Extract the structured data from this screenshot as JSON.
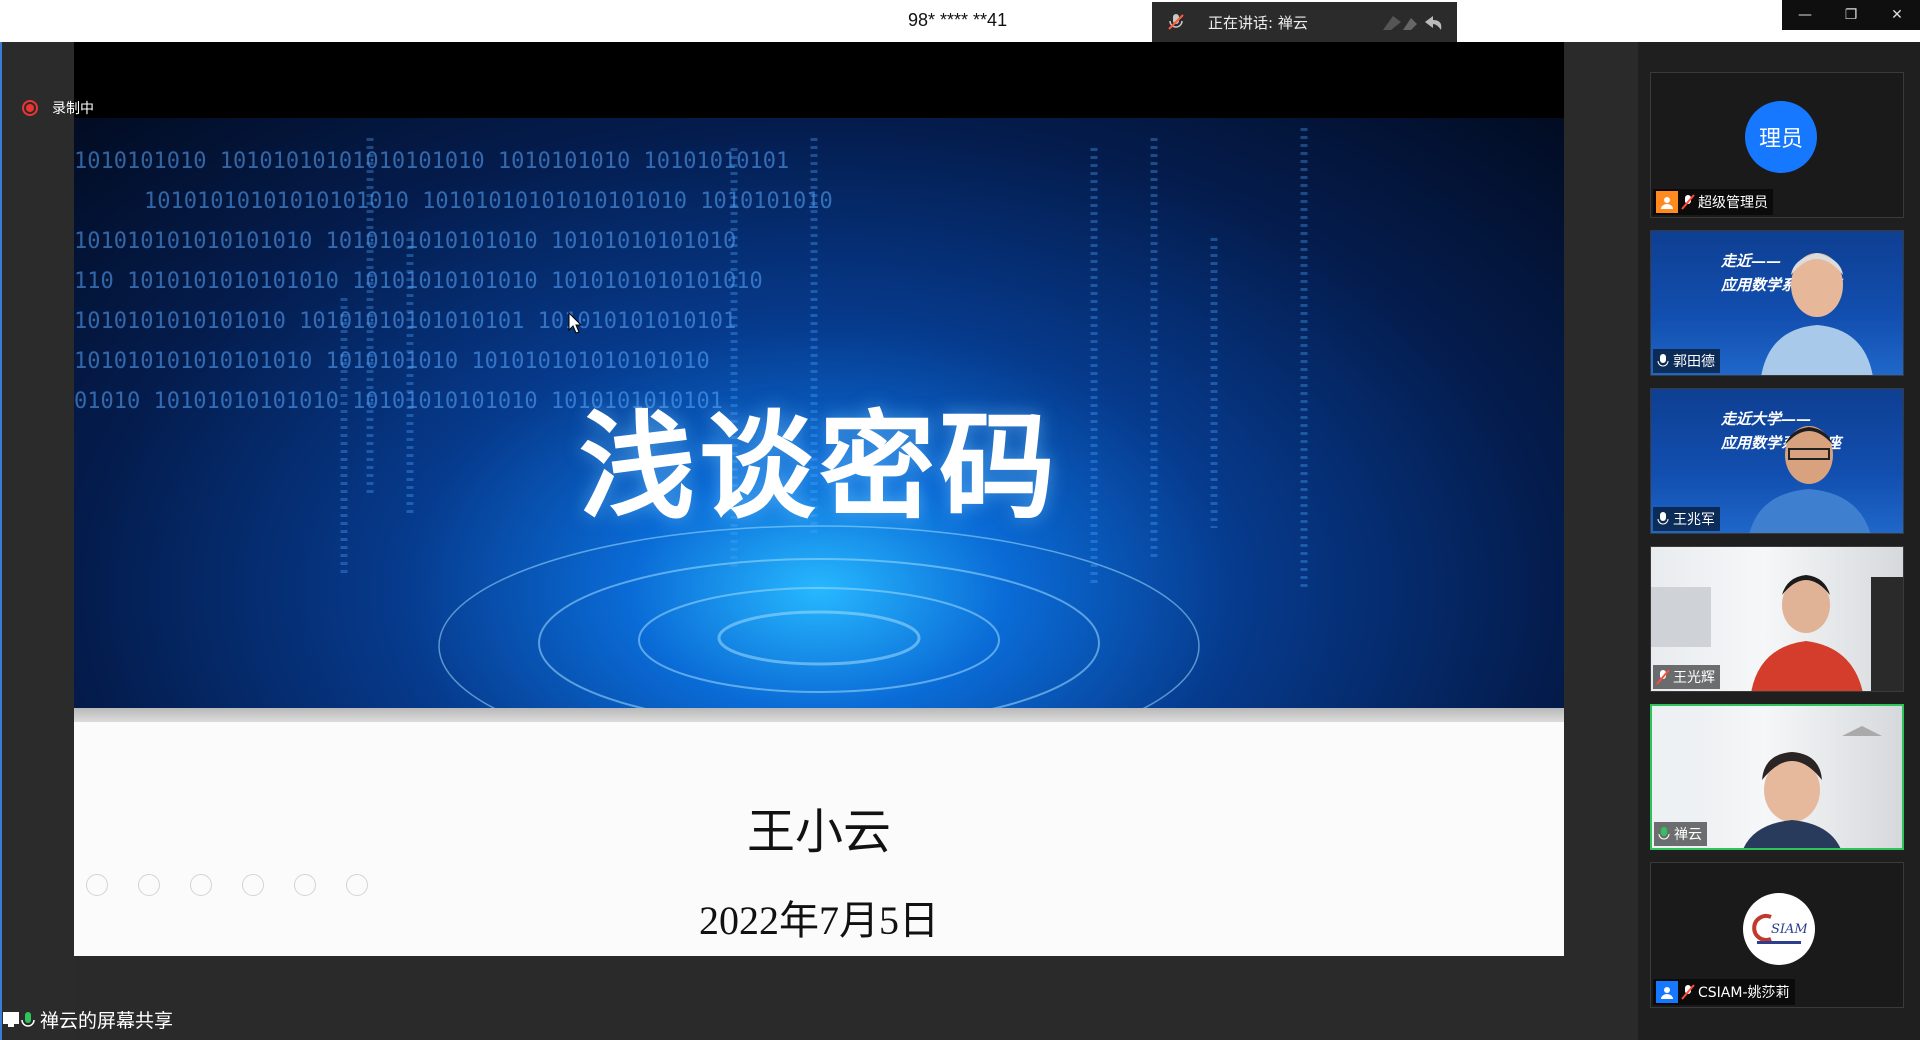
{
  "topbar": {
    "meeting_id": "98* **** **41",
    "speaking_label": "正在讲话: 禅云"
  },
  "window_controls": {
    "minimize": "—",
    "restore": "❐",
    "close": "✕"
  },
  "recording": {
    "label": "录制中"
  },
  "slide": {
    "title": "浅谈密码",
    "author": "王小云",
    "date": "2022年7月5日"
  },
  "share_label": "禅云的屏幕共享",
  "participants": [
    {
      "name": "超级管理员",
      "avatar_text": "理员",
      "mic": "muted",
      "type": "avatar"
    },
    {
      "name": "郭田德",
      "mic": "on",
      "type": "video",
      "banner": [
        "走近——",
        "应用数学系普讲座"
      ]
    },
    {
      "name": "王兆军",
      "mic": "on",
      "type": "video",
      "banner": [
        "走近大学——",
        "应用数学系普讲座"
      ]
    },
    {
      "name": "王光辉",
      "mic": "muted",
      "type": "video"
    },
    {
      "name": "禅云",
      "mic": "on",
      "type": "video",
      "active": true
    },
    {
      "name": "CSIAM-姚莎莉",
      "mic": "muted",
      "type": "logo"
    }
  ],
  "colors": {
    "accent_blue": "#1677ff",
    "active_green": "#2fc45b",
    "rec_red": "#e33333"
  }
}
